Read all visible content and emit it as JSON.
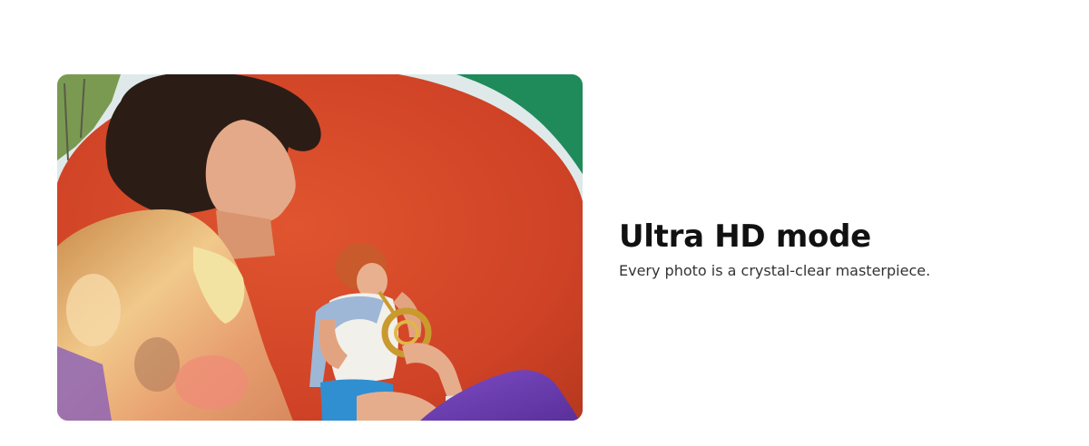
{
  "feature": {
    "title": "Ultra HD mode",
    "subtitle": "Every photo is a crystal-clear masterpiece."
  },
  "photo": {
    "colors": {
      "background_red": "#d4492c",
      "background_green": "#1f8a5a",
      "sky": "#dfe9ea",
      "jacket": "#e9b87a",
      "pants": "#6b3fb0",
      "shorts": "#2f8fd0",
      "horn": "#c99a2e"
    }
  }
}
